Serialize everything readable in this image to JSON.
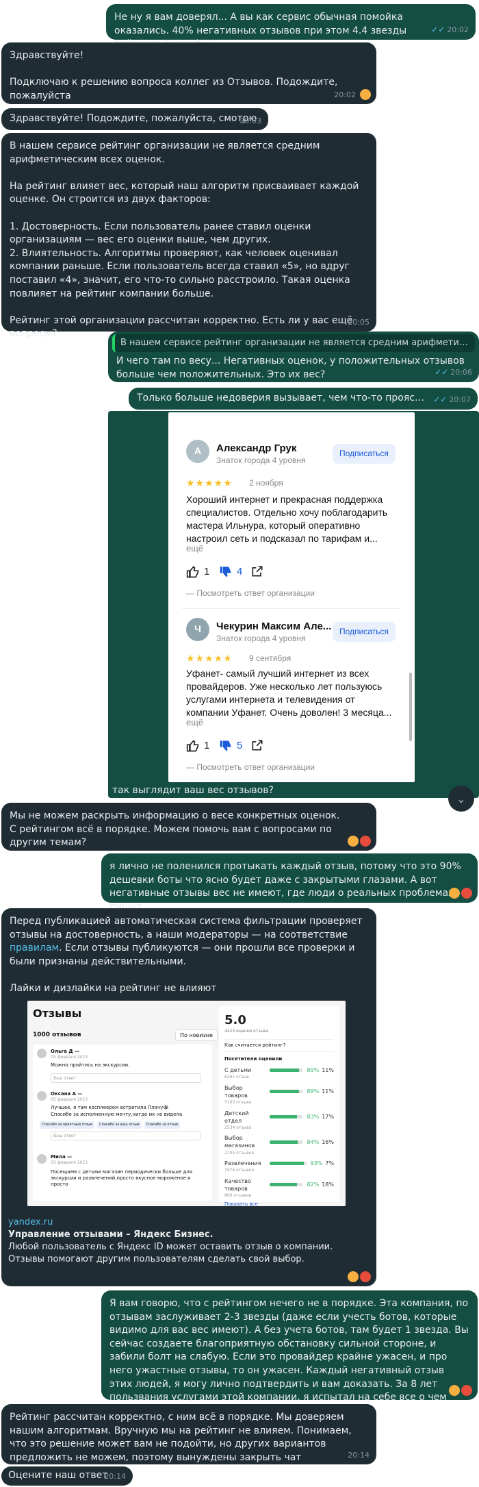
{
  "messages": {
    "m1": {
      "text": "Не ну я вам доверял... А вы как сервис обычная помойка оказались. 40% негативных отзывов при этом 4.4 звезды рейтинга аххахфых.",
      "time": "20:02"
    },
    "m2": {
      "text": "Здравствуйте!\n\nПодключаю к решению вопроса коллег из Отзывов. Подождите, пожалуйста",
      "time": "20:02"
    },
    "m3": {
      "text": "Здравствуйте! Подождите, пожалуйста, смотрю",
      "time": "20:03"
    },
    "m4": {
      "text": "В нашем сервисе рейтинг организации не является средним арифметическим всех оценок.\n\nНа рейтинг влияет вес, который наш алгоритм присваивает каждой оценке. Он строится из двух факторов:\n\n1. Достоверность. Если пользователь ранее ставил оценки организациям — вес его оценки выше, чем других.\n2. Влиятельность. Алгоритмы проверяют, как человек оценивал компании раньше. Если пользователь всегда ставил «5», но вдруг поставил «4», значит, его что-то сильно расстроило. Такая оценка повлияет на рейтинг компании больше.\n\nРейтинг этой организации рассчитан корректно. Есть ли у вас ещё вопросы?",
      "time": "20:05"
    },
    "m5": {
      "reply": "В нашем сервисе рейтинг организации не является средним арифметически...",
      "text": "И чего там по весу... Негативных оценок, у положительных отзывов больше чем положительных. Это их вес?",
      "time": "20:06"
    },
    "m6": {
      "text": "Только больше недоверия вызывает, чем что-то прояснили...",
      "time": "20:07"
    },
    "m7": {
      "caption": "так выглядит ваш вес отзывов?"
    },
    "m8": {
      "text": "Мы не можем раскрыть информацию о весе конкретных оценок. С рейтингом всё в порядке. Можем помочь вам с вопросами по другим темам?"
    },
    "m9": {
      "text": "я лично не поленился протыкать каждый отзыв, потому что это 90% дешевки боты что ясно будет даже с закрытыми глазами. А вот негативные отзывы вес не имеют, где люди о реальных проблемах пишут."
    },
    "m10": {
      "text_a": "Перед публикацией автоматическая система фильтрации проверяет отзывы на достоверность, а наши модераторы — на соответствие ",
      "link": "правилам",
      "text_b": ". Если отзывы публикуются — они прошли все проверки и были признаны действительными.\n\nЛайки и дизлайки на рейтинг не влияют",
      "preview_domain": "yandex.ru",
      "preview_title": "Управление отзывами – Яндекс Бизнес.",
      "preview_desc": "Любой пользователь с Яндекс ID может оставить отзыв о компании. Отзывы помогают другим пользователям сделать свой выбор."
    },
    "m11": {
      "text": "Я вам говорю, что с рейтингом нечего не в порядке. Эта компания, по отзывам заслуживает 2-3 звезды (даже если учесть ботов, которые видимо для вас вес имеют). А без учета ботов, там будет 1 звезда. Вы сейчас создаете благоприятную обстановку сильной стороне, и забили болт на слабую. Если это провайдер крайне ужасен, и про него ужастные отзывы, то он ужасен. Каждый негативный отзыв этих людей, я могу лично подтвердить и вам доказать. За 8 лет пользвания услугами этой компании, я испытал на себе все о чем пишут в этих отзывах."
    },
    "m12": {
      "text": "Рейтинг рассчитан корректно, с ним всё в порядке. Мы доверяем нашим алгоритмам. Вручную мы на рейтинг не влияем. Понимаем, что это решение может вам не подойти, но других вариантов предложить не можем, поэтому вынуждены закрыть чат",
      "time": "20:14"
    },
    "m13": {
      "text": "Оцените наш ответ",
      "time": "20:14"
    }
  },
  "reviews": [
    {
      "name": "Александр Грук",
      "level": "Знаток города 4 уровня",
      "subscribe": "Подписаться",
      "stars": "★★★★★",
      "date": "2 ноября",
      "text": "Хороший интернет и прекрасная поддержка специалистов. Отдельно хочу поблагодарить мастера Ильнура, который оперативно настроил сеть и подсказал по тарифам и...",
      "more": "ещё",
      "likes": "1",
      "dislikes": "4",
      "org_answer": "Посмотреть ответ организации"
    },
    {
      "name": "Чекурин Максим Але...",
      "level": "Знаток города 4 уровня",
      "subscribe": "Подписаться",
      "stars": "★★★★★",
      "date": "9 сентября",
      "text": "Уфанет- самый лучший интернет из всех провайдеров. Уже несколько лет пользуюсь услугами интернета и телевидения от компании Уфанет. Очень доволен! 3 месяца...",
      "more": "ещё",
      "likes": "1",
      "dislikes": "5",
      "org_answer": "Посмотреть ответ организации"
    }
  ],
  "screenshot_panel": {
    "title": "Отзывы",
    "count": "1000 отзывов",
    "sort": "По новизне",
    "rating": "5.0",
    "rating_sub": "4423 оценки отзыва",
    "how_label": "Как считается рейтинг?",
    "visitors_label": "Посетители оценили",
    "aspects": [
      {
        "name": "С детьми",
        "sub": "6291 отзыв",
        "pos": "89%",
        "neg": "11%",
        "fill": 0.89
      },
      {
        "name": "Выбор товаров",
        "sub": "5103 отзыва",
        "pos": "89%",
        "neg": "11%",
        "fill": 0.89
      },
      {
        "name": "Детский отдел",
        "sub": "2534 отзыва",
        "pos": "83%",
        "neg": "17%",
        "fill": 0.83
      },
      {
        "name": "Выбор магазинов",
        "sub": "2105 отзывов",
        "pos": "84%",
        "neg": "16%",
        "fill": 0.84
      },
      {
        "name": "Развлечения",
        "sub": "1976 отзывов",
        "pos": "93%",
        "neg": "7%",
        "fill": 0.93
      },
      {
        "name": "Качество товаров",
        "sub": "860 отзывов",
        "pos": "82%",
        "neg": "18%",
        "fill": 0.82
      }
    ],
    "show_all": "Показать все",
    "reviews": [
      {
        "name": "Ольга Д —",
        "date": "05 февраля 2023",
        "text": "Можно пройтись на экскурсии.",
        "reply": "Ваш ответ"
      },
      {
        "name": "Оксана А —",
        "date": "05 февраля 2023",
        "text": "Лучшее, я там косплеером встретила Плачу😭\nСпасибо за исполненную мечту,нигде их не видела",
        "reply": "Ваш ответ"
      },
      {
        "name": "Мила —",
        "date": "03 февраля 2023",
        "text": "Посещаем с детьми магазин периодически больше для экскурсии и развлечений,просто вкусное мороженое и просто",
        "reply": ""
      }
    ],
    "chips": [
      "Спасибо за приятный отзыв",
      "Спасибо за ваш отзыв",
      "Спасибо за отзыв"
    ]
  }
}
